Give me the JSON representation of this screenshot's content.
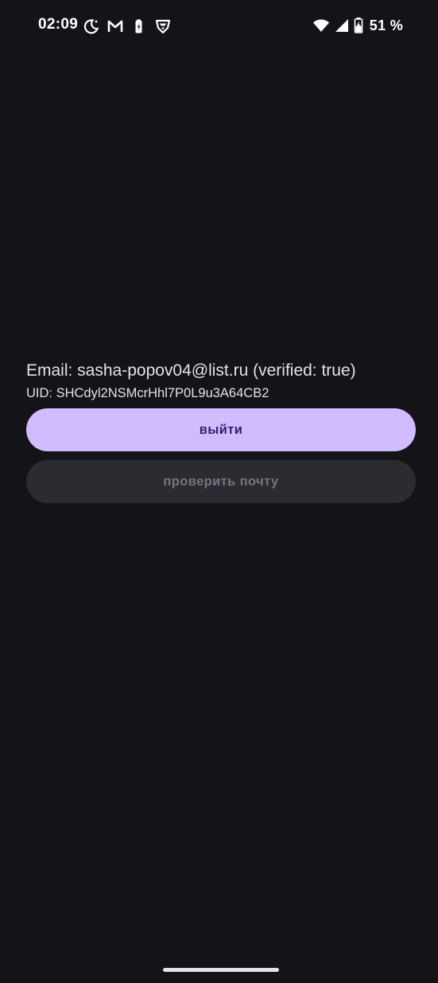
{
  "status_bar": {
    "time": "02:09",
    "left_icons": [
      "do-not-disturb-moon-icon",
      "gmail-icon",
      "battery-saver-icon",
      "shield-icon"
    ],
    "right_icons": [
      "wifi-icon",
      "cellular-signal-icon",
      "battery-charging-icon"
    ],
    "battery_percent": "51 %"
  },
  "account": {
    "email_line": "Email: sasha-popov04@list.ru (verified: true)",
    "uid_line": "UID: SHCdyl2NSMcrHhl7P0L9u3A64CB2"
  },
  "buttons": {
    "logout_label": "выйти",
    "verify_email_label": "проверить почту"
  },
  "colors": {
    "background": "#141318",
    "primary_button": "#d0bcff",
    "primary_button_text": "#381e72",
    "disabled_button": "#2c2b31",
    "disabled_button_text": "#77757c",
    "text": "#e6e1e6"
  }
}
